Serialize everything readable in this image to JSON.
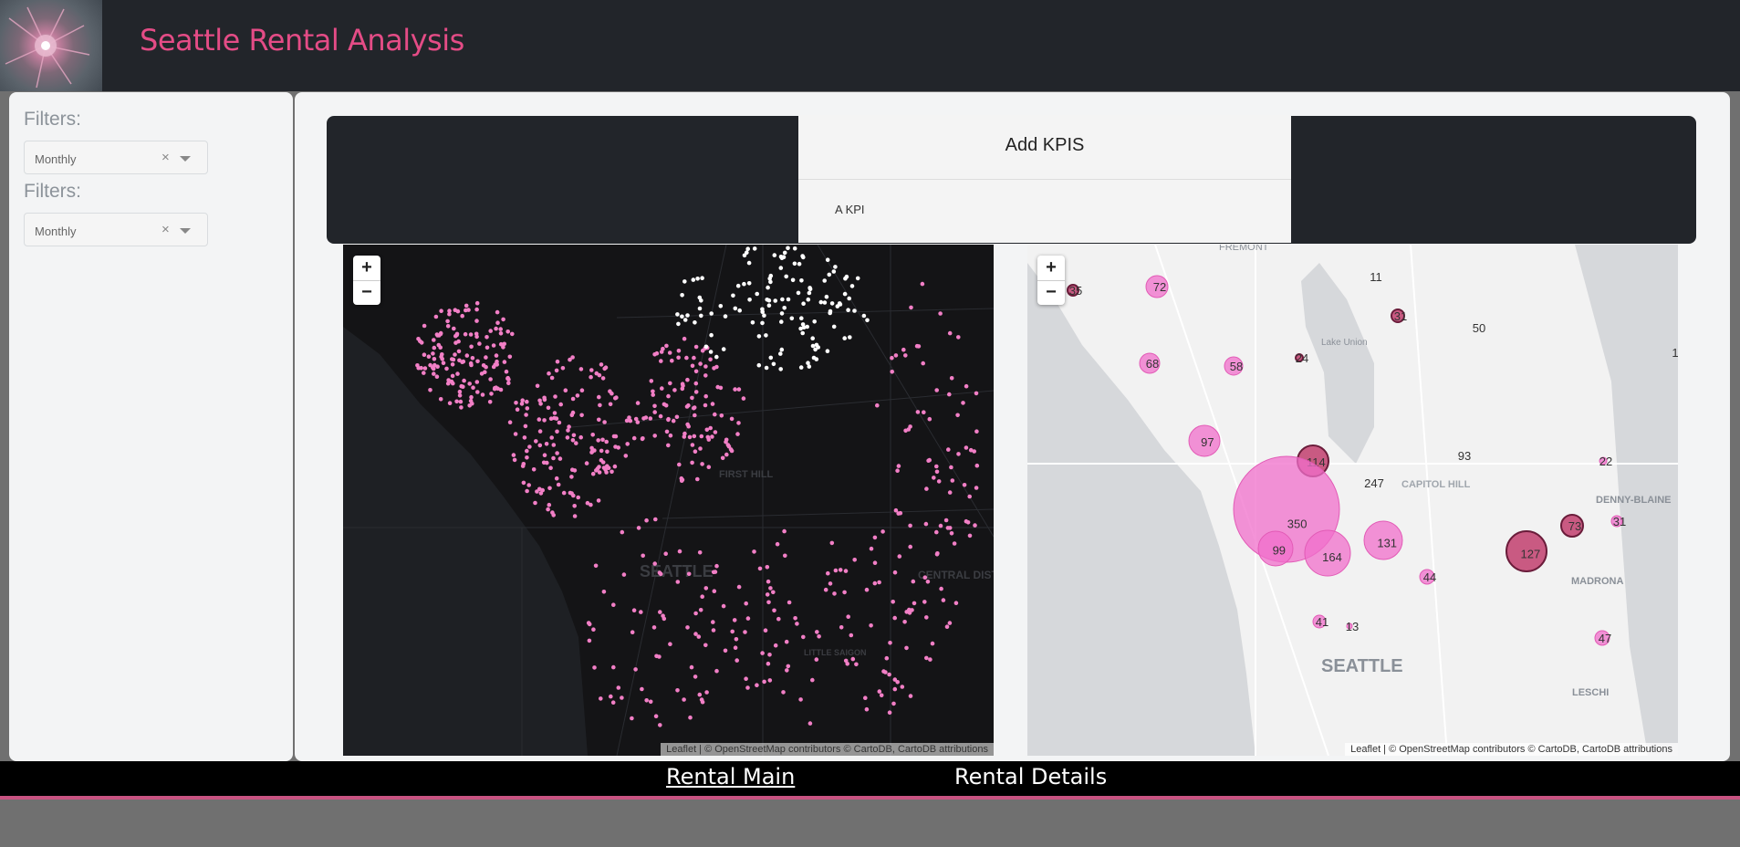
{
  "header": {
    "title": "Seattle Rental Analysis"
  },
  "sidebar": {
    "filters": [
      {
        "label": "Filters:",
        "value": "Monthly",
        "clear": "×"
      },
      {
        "label": "Filters:",
        "value": "Monthly",
        "clear": "×"
      }
    ]
  },
  "kpi": {
    "title": "Add KPIS",
    "items": [
      "A KPI"
    ]
  },
  "maps": {
    "zoom_in": "+",
    "zoom_out": "−",
    "left": {
      "attribution": "Leaflet | © OpenStreetMap contributors © CartoDB, CartoDB attributions",
      "labels": [
        "SEATTLE",
        "CENTRAL DISTRICT",
        "FIRST HILL",
        "LITTLE SAIGON"
      ]
    },
    "right": {
      "attribution": "Leaflet | © OpenStreetMap contributors © CartoDB, CartoDB attributions",
      "labels": [
        "FREMONT",
        "Lake Union",
        "CAPITOL HILL",
        "DENNY-BLAINE",
        "MADRONA",
        "SEATTLE",
        "LESCHI"
      ],
      "counts": [
        "35",
        "72",
        "11",
        "31",
        "50",
        "1",
        "68",
        "58",
        "24",
        "97",
        "114",
        "93",
        "22",
        "247",
        "350",
        "73",
        "31",
        "99",
        "164",
        "131",
        "127",
        "44",
        "41",
        "13",
        "47"
      ]
    }
  },
  "nav": {
    "links": [
      "Rental Main",
      "Rental Details"
    ]
  },
  "colors": {
    "accent": "#e44c86",
    "point_pink": "#f27fc6",
    "point_white": "#ffffff",
    "footer_line": "#c75381"
  }
}
